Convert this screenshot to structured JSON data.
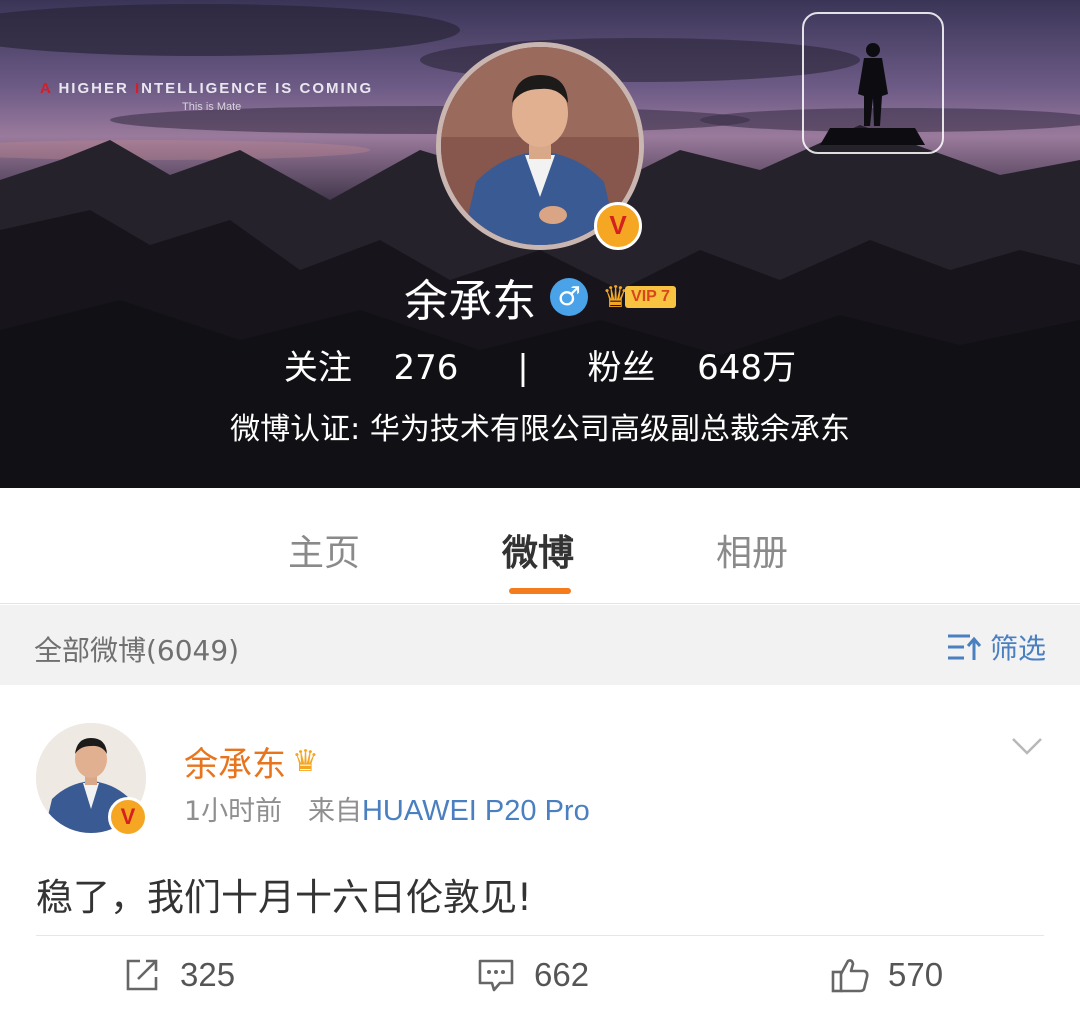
{
  "cover": {
    "tagline_a": "A",
    "tagline_1": " HIGHER ",
    "tagline_i": "I",
    "tagline_2": "NTELLIGENCE IS COMING",
    "subtagline": "This is Mate"
  },
  "profile": {
    "name": "余承东",
    "gender_icon": "♂",
    "vip_label": "VIP 7",
    "following_label": "关注",
    "following_count": "276",
    "separator": "|",
    "followers_label": "粉丝",
    "followers_count": "648万",
    "verification": "微博认证: 华为技术有限公司高级副总裁余承东"
  },
  "tabs": [
    {
      "label": "主页"
    },
    {
      "label": "微博"
    },
    {
      "label": "相册"
    }
  ],
  "filterbar": {
    "label": "全部微博(6049)",
    "filter_label": "筛选"
  },
  "post": {
    "author": "余承东",
    "time": "1小时前",
    "source_prefix": "来自",
    "source": "HUAWEI P20 Pro",
    "text": "稳了，我们十月十六日伦敦见!",
    "reposts": "325",
    "comments": "662",
    "likes": "570"
  },
  "badges": {
    "verified": "V"
  },
  "colors": {
    "accent_orange": "#f47c1d",
    "link_blue": "#4a7fc0",
    "badge_orange": "#f5a623"
  }
}
